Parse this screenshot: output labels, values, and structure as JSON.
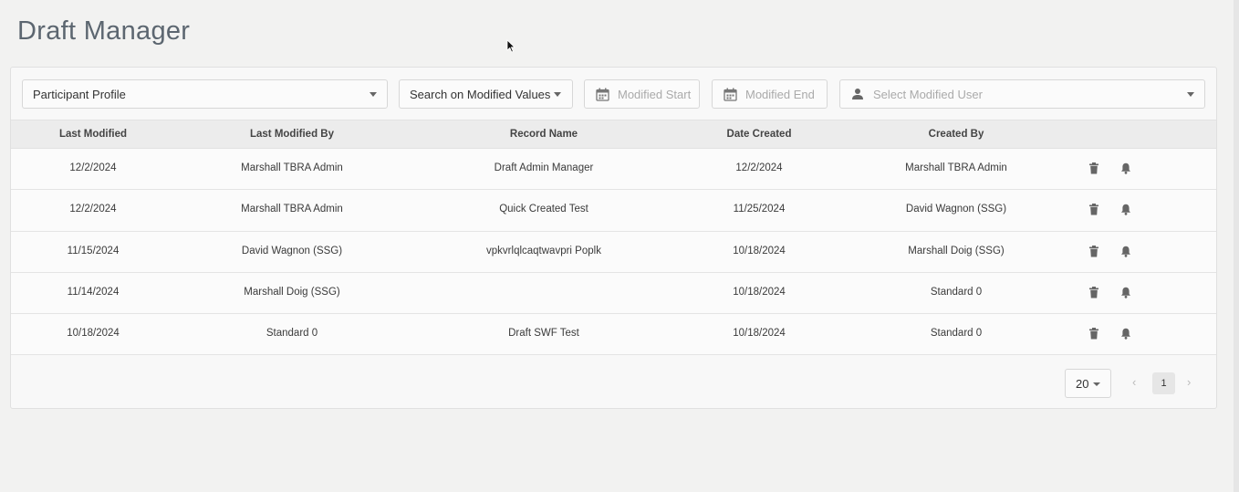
{
  "title": "Draft Manager",
  "toolbar": {
    "profile_value": "Participant Profile",
    "search_mode": "Search on Modified Values",
    "modified_start_placeholder": "Modified Start",
    "modified_end_placeholder": "Modified End",
    "user_placeholder": "Select Modified User"
  },
  "table": {
    "headers": [
      "Last Modified",
      "Last Modified By",
      "Record Name",
      "Date Created",
      "Created By"
    ],
    "rows": [
      [
        "12/2/2024",
        "Marshall TBRA Admin",
        "Draft Admin Manager",
        "12/2/2024",
        "Marshall TBRA Admin"
      ],
      [
        "12/2/2024",
        "Marshall TBRA Admin",
        "Quick Created Test",
        "11/25/2024",
        "David Wagnon (SSG)"
      ],
      [
        "11/15/2024",
        "David Wagnon (SSG)",
        "vpkvrlqlcaqtwavpri Poplk",
        "10/18/2024",
        "Marshall Doig (SSG)"
      ],
      [
        "11/14/2024",
        "Marshall Doig (SSG)",
        "",
        "10/18/2024",
        "Standard 0"
      ],
      [
        "10/18/2024",
        "Standard 0",
        "Draft SWF Test",
        "10/18/2024",
        "Standard 0"
      ]
    ]
  },
  "pagination": {
    "page_size": "20",
    "current_page": "1"
  },
  "icons": {
    "delete": "trash-icon",
    "notify": "bell-icon",
    "calendar": "calendar-icon",
    "user": "person-icon"
  }
}
